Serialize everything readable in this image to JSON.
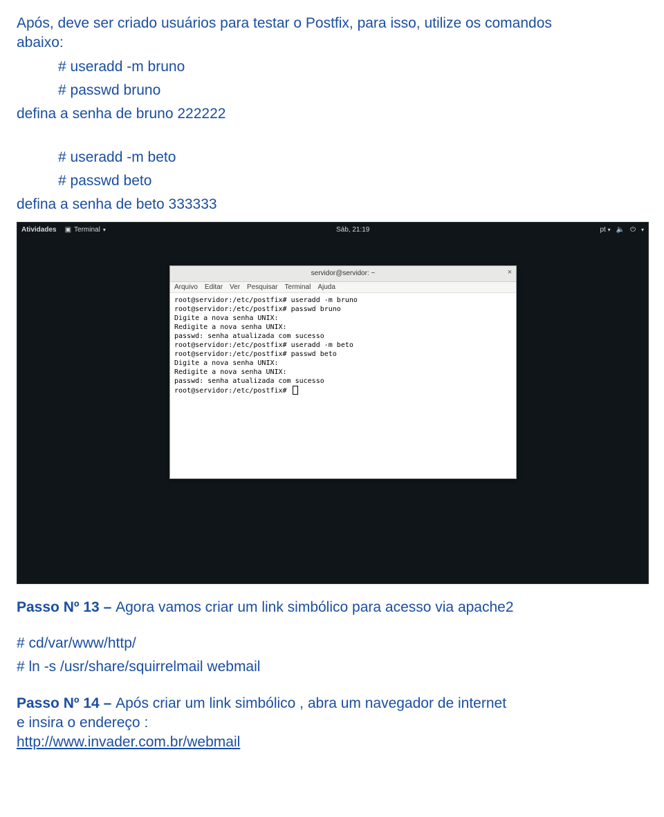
{
  "doc": {
    "intro_line1": "Após, deve ser criado usuários para testar o Postfix, para isso, utilize os comandos",
    "intro_line2": "abaixo:",
    "cmd1": "# useradd -m bruno",
    "cmd2": "# passwd bruno",
    "def_bruno": "defina a senha de bruno 222222",
    "cmd3": "# useradd -m beto",
    "cmd4": "# passwd beto",
    "def_beto": "defina a senha de beto 333333",
    "step13_prefix": "Passo Nº 13 – ",
    "step13_rest": "Agora vamos criar um link simbólico para acesso via apache2",
    "cmd_cd": "# cd/var/www/http/",
    "cmd_ln": "# ln -s /usr/share/squirrelmail webmail",
    "step14_prefix": "Passo Nº 14 – ",
    "step14_rest1": "Após criar um link simbólico , abra um navegador de internet",
    "step14_rest2": "e insira o endereço :",
    "step14_url": "http://www.invader.com.br/webmail"
  },
  "panel": {
    "activities": "Atividades",
    "app": "Terminal",
    "clock": "Sáb, 21:19",
    "lang": "pt"
  },
  "termwin": {
    "title": "servidor@servidor: ~",
    "menus": [
      "Arquivo",
      "Editar",
      "Ver",
      "Pesquisar",
      "Terminal",
      "Ajuda"
    ],
    "lines": [
      "root@servidor:/etc/postfix# useradd -m bruno",
      "root@servidor:/etc/postfix# passwd bruno",
      "Digite a nova senha UNIX:",
      "Redigite a nova senha UNIX:",
      "passwd: senha atualizada com sucesso",
      "root@servidor:/etc/postfix# useradd -m beto",
      "root@servidor:/etc/postfix# passwd beto",
      "Digite a nova senha UNIX:",
      "Redigite a nova senha UNIX:",
      "passwd: senha atualizada com sucesso",
      "root@servidor:/etc/postfix# "
    ]
  }
}
